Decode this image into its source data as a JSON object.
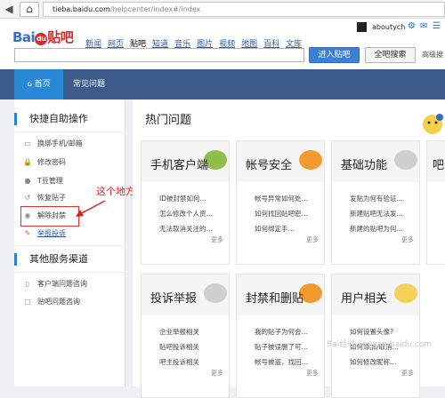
{
  "browser": {
    "url_host": "tieba.baidu.com",
    "url_path": "/helpcenter/index#/index"
  },
  "header": {
    "logo_left": "Bai",
    "logo_paw": "du",
    "logo_right": "贴吧",
    "nav": [
      "新闻",
      "网页",
      "贴吧",
      "知道",
      "音乐",
      "图片",
      "视频",
      "地图",
      "百科",
      "文库"
    ],
    "current_nav": "贴吧",
    "search_value": "",
    "enter_label": "进入贴吧",
    "search_label": "全吧搜索",
    "advanced_label": "高级搜",
    "username": "aboutych"
  },
  "mainnav": {
    "home": "首页",
    "faq": "常见问题"
  },
  "sidebar": {
    "section1_title": "快捷自助操作",
    "items": [
      {
        "label": "换绑手机/邮箱",
        "icon": "phone-icon"
      },
      {
        "label": "修改密码",
        "icon": "lock-icon"
      },
      {
        "label": "T豆管理",
        "icon": "coin-icon"
      },
      {
        "label": "恢复贴子",
        "icon": "restore-icon"
      },
      {
        "label": "解除封禁",
        "icon": "unban-icon"
      },
      {
        "label": "举报投诉",
        "icon": "report-icon"
      }
    ],
    "section2_title": "其他服务渠道",
    "channels": [
      {
        "label": "客户端问题咨询",
        "icon": "mobile-icon"
      },
      {
        "label": "贴吧问题咨询",
        "icon": "chat-icon"
      }
    ]
  },
  "annotation": "这个地方",
  "main": {
    "title": "热门问题",
    "cards": [
      {
        "title": "手机客户端",
        "color": "#8fbf4a",
        "links": [
          "ID被封禁如何…",
          "怎么修改个人资…",
          "无法取消关注的…"
        ],
        "more": "更多"
      },
      {
        "title": "帐号安全",
        "color": "#f39a2e",
        "links": [
          "帐号异常如何处…",
          "如何找回贴吧密…",
          "如何绑定手…"
        ],
        "more": "更多"
      },
      {
        "title": "基础功能",
        "color": "#cfcfcf",
        "links": [
          "发贴为何有验证…",
          "新建贴吧无法发…",
          "新建的贴吧为何…"
        ],
        "more": "更多"
      },
      {
        "title": "吧",
        "color": "#cfcfcf",
        "links": [
          "",
          "",
          ""
        ],
        "more": ""
      },
      {
        "title": "投诉举报",
        "color": "#cfcfcf",
        "links": [
          "企业举报相关",
          "贴吧投诉相关",
          "吧主投诉相关"
        ],
        "more": "更多"
      },
      {
        "title": "封禁和删贴",
        "color": "#f39a2e",
        "links": [
          "我的贴子为何会…",
          "贴子被误删了可…",
          "帐号被盗，找回…"
        ],
        "more": "更多"
      },
      {
        "title": "用户相关",
        "color": "#f4d25a",
        "links": [
          "如何设置头像?",
          "如何添加/取消…",
          "如何修改昵称…"
        ],
        "more": "更多"
      }
    ]
  },
  "watermark": "Bai经验 jingyan.baidu.com"
}
